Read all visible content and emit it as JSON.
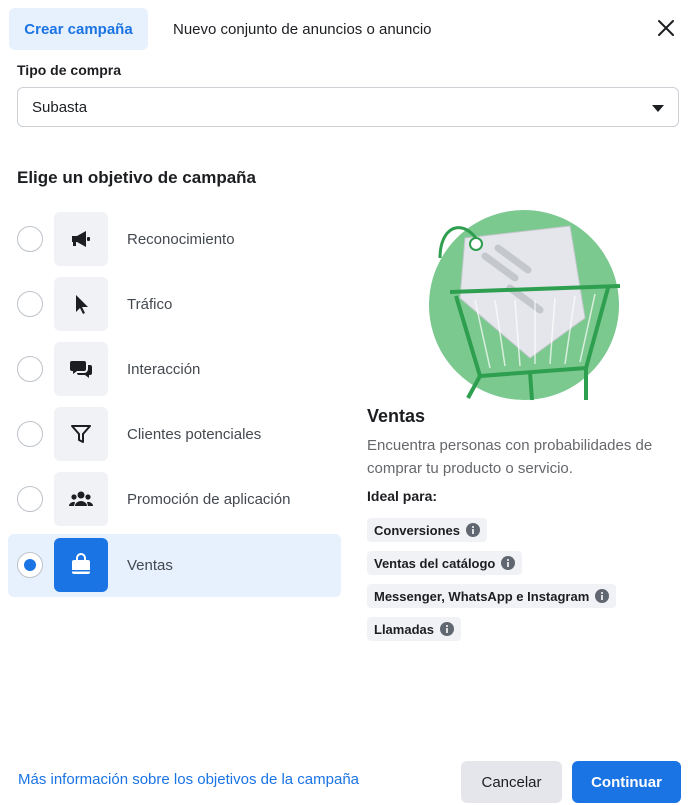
{
  "tabs": [
    {
      "label": "Crear campaña",
      "active": true
    },
    {
      "label": "Nuevo conjunto de anuncios o anuncio",
      "active": false
    }
  ],
  "close_icon": "close-icon",
  "buy_type": {
    "label": "Tipo de compra",
    "value": "Subasta"
  },
  "section_title": "Elige un objetivo de campaña",
  "objectives": [
    {
      "label": "Reconocimiento",
      "icon": "megaphone-icon",
      "selected": false
    },
    {
      "label": "Tráfico",
      "icon": "cursor-icon",
      "selected": false
    },
    {
      "label": "Interacción",
      "icon": "chat-bubbles-icon",
      "selected": false
    },
    {
      "label": "Clientes potenciales",
      "icon": "funnel-icon",
      "selected": false
    },
    {
      "label": "Promoción de aplicación",
      "icon": "people-icon",
      "selected": false
    },
    {
      "label": "Ventas",
      "icon": "shopping-bag-icon",
      "selected": true
    }
  ],
  "detail": {
    "title": "Ventas",
    "description": "Encuentra personas con probabilidades de comprar tu producto o servicio.",
    "ideal_label": "Ideal para:",
    "chips": [
      "Conversiones",
      "Ventas del catálogo",
      "Messenger, WhatsApp e Instagram",
      "Llamadas"
    ]
  },
  "footer": {
    "link": "Más información sobre los objetivos de la campaña",
    "cancel": "Cancelar",
    "continue": "Continuar"
  },
  "colors": {
    "accent": "#1b74e4",
    "selected_bg": "#e7f0fd",
    "illustration_green": "#7cc990"
  }
}
